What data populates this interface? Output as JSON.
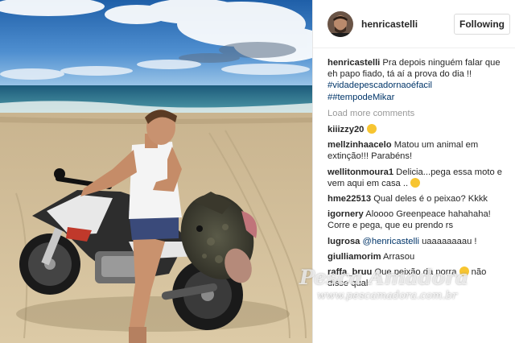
{
  "post": {
    "username": "henricastelli",
    "follow_label": "Following"
  },
  "caption": {
    "user": "henricastelli",
    "text": "Pra depois ninguém falar que eh papo fiado, tá aí a prova do dia !!",
    "hashtag1": "#vidadepescadornaoéfacil",
    "hashtag2": "##tempodeMikar"
  },
  "load_more_label": "Load more comments",
  "comments": [
    {
      "user": "kiiizzy20",
      "text": "",
      "emoji": "heart-eyes-emoji"
    },
    {
      "user": "mellzinhaacelo",
      "text": "Matou um animal em extinção!!! Parabéns!"
    },
    {
      "user": "wellitonmoura1",
      "text": "Delicia...pega essa moto e vem aqui em casa ..",
      "emoji": "smirk-emoji"
    },
    {
      "user": "hme22513",
      "text": "Qual deles é o peixao? Kkkk"
    },
    {
      "user": "igornery",
      "text": "Aloooo Greenpeace hahahaha! Corre e pega, que eu prendo rs"
    },
    {
      "user": "lugrosa",
      "mention": "@henricastelli",
      "text": " uaaaaaaaau !"
    },
    {
      "user": "giulliamorim",
      "text": "Arrasou"
    },
    {
      "user": "raffa_bruu",
      "text": "Que peixão da porra",
      "emoji": "joy-emoji",
      "text_after": "não disse qual"
    }
  ],
  "watermark": {
    "title": "Pesca Amadora",
    "url": "www.pescamadora.com.br"
  },
  "colors": {
    "link": "#003569",
    "username": "#262626",
    "muted": "#999999",
    "emoji_yellow": "#f7c531"
  }
}
